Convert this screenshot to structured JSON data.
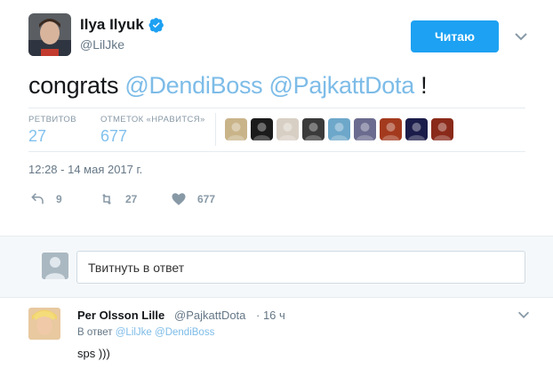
{
  "tweet": {
    "author_name": "Ilya Ilyuk",
    "author_handle": "@LilJke",
    "follow_label": "Читаю",
    "text_prefix": "congrats ",
    "mention_1": "@DendiBoss",
    "mention_2": "@PajkattDota",
    "text_suffix": " !",
    "stats": {
      "retweets_label": "РЕТВИТОВ",
      "retweets_value": "27",
      "likes_label": "ОТМЕТОК «НРАВИТСЯ»",
      "likes_value": "677"
    },
    "liker_colors": [
      "#c9b48a",
      "#1b1b1b",
      "#d8cfc4",
      "#3a3a3a",
      "#6da7c9",
      "#6b6b8f",
      "#a33a1e",
      "#1c1c4a",
      "#8a2a1a"
    ],
    "timestamp": "12:28 - 14 мая 2017 г.",
    "actions": {
      "reply_count": "9",
      "retweet_count": "27",
      "like_count": "677"
    }
  },
  "reply_box": {
    "placeholder": "Твитнуть в ответ"
  },
  "reply_tweet": {
    "name": "Per Olsson Lille",
    "handle": "@PajkattDota",
    "time": "· 16 ч",
    "reply_prefix": "В ответ",
    "reply_to_1": "@LilJke",
    "reply_to_2": "@DendiBoss",
    "text": "sps )))"
  },
  "colors": {
    "accent": "#1da1f2",
    "link": "#7dbce8",
    "muted": "#657786"
  }
}
